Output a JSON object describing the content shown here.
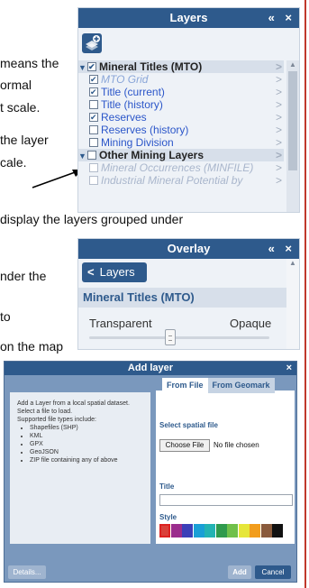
{
  "doc_text": {
    "line1": "means the",
    "line2": "ormal",
    "line3": "t scale.",
    "line4": "the layer",
    "line5": "cale.",
    "line6": "display the layers grouped under",
    "line7": "nder the",
    "line8": "to",
    "line9": "on the map"
  },
  "layers_panel": {
    "title": "Layers",
    "header_controls": "« ×",
    "add_icon": "layer-add-icon",
    "groups": [
      {
        "label": "Mineral Titles (MTO)",
        "items": [
          {
            "label": "MTO Grid",
            "checked": true,
            "style": "italic"
          },
          {
            "label": "Title (current)",
            "checked": true,
            "style": "normal"
          },
          {
            "label": "Title (history)",
            "checked": false,
            "style": "normal"
          },
          {
            "label": "Reserves",
            "checked": true,
            "style": "normal"
          },
          {
            "label": "Reserves (history)",
            "checked": false,
            "style": "normal"
          },
          {
            "label": "Mining Division",
            "checked": false,
            "style": "normal"
          }
        ]
      },
      {
        "label": "Other Mining Layers",
        "items": [
          {
            "label": "Mineral Occurrences (MINFILE)",
            "checked": false,
            "style": "muted"
          },
          {
            "label": "Industrial Mineral Potential by",
            "checked": false,
            "style": "muted"
          }
        ]
      }
    ]
  },
  "overlay_panel": {
    "title": "Overlay",
    "header_controls": "« ×",
    "back_label": "Layers",
    "layer_name": "Mineral Titles (MTO)",
    "left_label": "Transparent",
    "right_label": "Opaque",
    "opacity_fraction": 0.45
  },
  "add_layer_dialog": {
    "title": "Add layer",
    "close": "×",
    "help_intro": "Add a Layer from a local spatial dataset.",
    "help_select": "Select a file to load.",
    "help_types_heading": "Supported file types include:",
    "help_types": [
      "Shapefiles (SHP)",
      "KML",
      "GPX",
      "GeoJSON",
      "ZIP file containing any of above"
    ],
    "tabs": [
      "From File",
      "From Geomark"
    ],
    "active_tab": 0,
    "select_label": "Select spatial file",
    "choose_button": "Choose File",
    "file_status": "No file chosen",
    "title_label": "Title",
    "title_value": "",
    "style_label": "Style",
    "swatch_colors": [
      "#d9413b",
      "#9b2c8c",
      "#3b3fb8",
      "#1a9fd6",
      "#23b3b3",
      "#2f9a4d",
      "#6fc04a",
      "#e6e63a",
      "#f29d1c",
      "#8a5a3b",
      "#111111"
    ],
    "selected_swatch": 0,
    "details_button": "Details...",
    "add_button": "Add",
    "cancel_button": "Cancel"
  }
}
